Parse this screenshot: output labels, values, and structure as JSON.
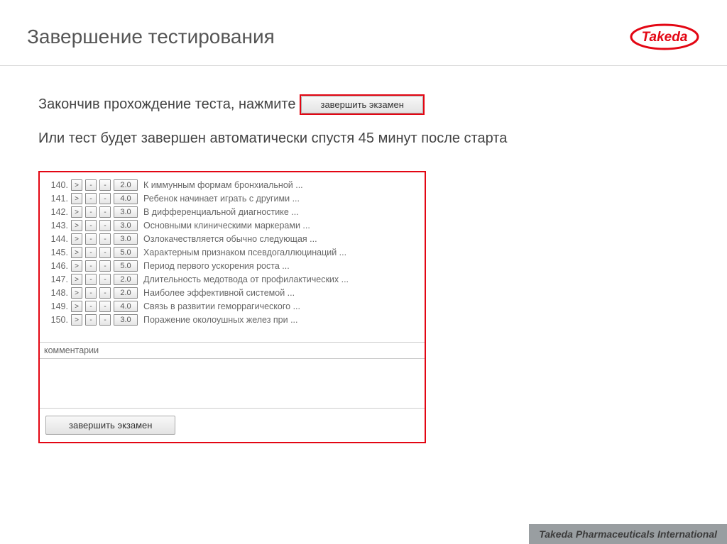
{
  "header": {
    "title": "Завершение тестирования",
    "brand": "Takeda"
  },
  "body": {
    "line1_prefix": "Закончив прохождение теста, нажмите",
    "finish_button_label": "завершить экзамен",
    "line2": "Или тест будет завершен автоматически спустя 45 минут после старта"
  },
  "panel": {
    "questions": [
      {
        "num": "140.",
        "score": "2.0",
        "text": "К иммунным формам бронхиальной ..."
      },
      {
        "num": "141.",
        "score": "4.0",
        "text": "Ребенок начинает играть с другими ..."
      },
      {
        "num": "142.",
        "score": "3.0",
        "text": "В дифференциальной диагностике ..."
      },
      {
        "num": "143.",
        "score": "3.0",
        "text": "Основными клиническими маркерами ..."
      },
      {
        "num": "144.",
        "score": "3.0",
        "text": "Озлокачествляется обычно следующая ..."
      },
      {
        "num": "145.",
        "score": "5.0",
        "text": "Характерным признаком псевдогаллюцинаций ..."
      },
      {
        "num": "146.",
        "score": "5.0",
        "text": "Период первого ускорения роста ..."
      },
      {
        "num": "147.",
        "score": "2.0",
        "text": "Длительность медотвода от профилактических ..."
      },
      {
        "num": "148.",
        "score": "2.0",
        "text": "Наиболее эффективной системой ..."
      },
      {
        "num": "149.",
        "score": "4.0",
        "text": "Связь в развитии геморрагического ..."
      },
      {
        "num": "150.",
        "score": "3.0",
        "text": "Поражение околоушных желез при ..."
      }
    ],
    "go_label": ">",
    "dash_label": "-",
    "comments_label": "комментарии",
    "finish_button_label": "завершить экзамен"
  },
  "footer": {
    "text": "Takeda Pharmaceuticals International"
  }
}
